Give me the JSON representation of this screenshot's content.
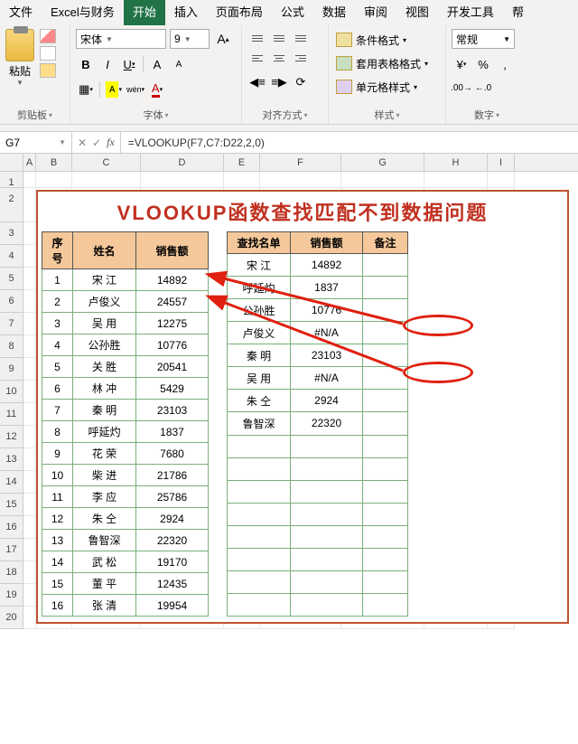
{
  "menu": [
    "文件",
    "Excel与财务",
    "开始",
    "插入",
    "页面布局",
    "公式",
    "数据",
    "审阅",
    "视图",
    "开发工具",
    "帮"
  ],
  "active_menu_index": 2,
  "ribbon": {
    "clipboard": {
      "paste": "粘贴",
      "label": "剪贴板"
    },
    "font": {
      "name": "宋体",
      "size": "9",
      "bold": "B",
      "italic": "I",
      "underline": "U",
      "label": "字体",
      "wen": "wén"
    },
    "align": {
      "label": "对齐方式"
    },
    "styles": {
      "cond": "条件格式",
      "table": "套用表格格式",
      "cell": "单元格样式",
      "label": "样式"
    },
    "number": {
      "format": "常规",
      "label": "数字"
    }
  },
  "formula_bar": {
    "cell_ref": "G7",
    "formula": "=VLOOKUP(F7,C7:D22,2,0)"
  },
  "columns": [
    "A",
    "B",
    "C",
    "D",
    "E",
    "F",
    "G",
    "H",
    "I"
  ],
  "title": "VLOOKUP函数查找匹配不到数据问题",
  "table1": {
    "headers": [
      "序号",
      "姓名",
      "销售额"
    ],
    "rows": [
      [
        "1",
        "宋  江",
        "14892"
      ],
      [
        "2",
        "卢俊义",
        "24557"
      ],
      [
        "3",
        "吴  用",
        "12275"
      ],
      [
        "4",
        "公孙胜",
        "10776"
      ],
      [
        "5",
        "关  胜",
        "20541"
      ],
      [
        "6",
        "林  冲",
        "5429"
      ],
      [
        "7",
        "秦  明",
        "23103"
      ],
      [
        "8",
        "呼延灼",
        "1837"
      ],
      [
        "9",
        "花  荣",
        "7680"
      ],
      [
        "10",
        "柴  进",
        "21786"
      ],
      [
        "11",
        "李  应",
        "25786"
      ],
      [
        "12",
        "朱  仝",
        "2924"
      ],
      [
        "13",
        "鲁智深",
        "22320"
      ],
      [
        "14",
        "武  松",
        "19170"
      ],
      [
        "15",
        "董  平",
        "12435"
      ],
      [
        "16",
        "张  清",
        "19954"
      ]
    ]
  },
  "table2": {
    "headers": [
      "查找名单",
      "销售额",
      "备注"
    ],
    "rows": [
      [
        "宋  江",
        "14892",
        ""
      ],
      [
        "呼延灼",
        "1837",
        ""
      ],
      [
        "公孙胜",
        "10776",
        ""
      ],
      [
        "卢俊义",
        "#N/A",
        ""
      ],
      [
        "秦  明",
        "23103",
        ""
      ],
      [
        "吴  用",
        "#N/A",
        ""
      ],
      [
        "朱  仝",
        "2924",
        ""
      ],
      [
        "鲁智深",
        "22320",
        ""
      ],
      [
        "",
        "",
        ""
      ],
      [
        "",
        "",
        ""
      ],
      [
        "",
        "",
        ""
      ],
      [
        "",
        "",
        ""
      ],
      [
        "",
        "",
        ""
      ],
      [
        "",
        "",
        ""
      ],
      [
        "",
        "",
        ""
      ],
      [
        "",
        "",
        ""
      ]
    ]
  }
}
